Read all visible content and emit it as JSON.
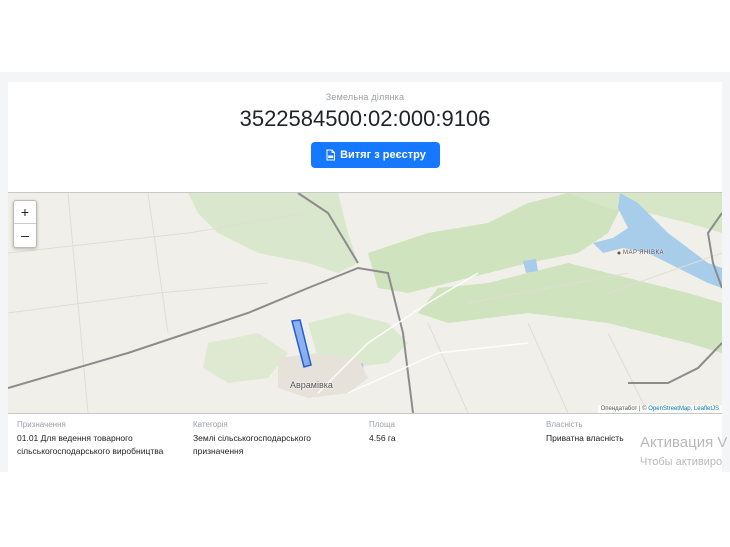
{
  "header": {
    "subtitle": "Земельна ділянка",
    "cadastral_number": "3522584500:02:000:9106",
    "extract_button_label": "Витяг з реєстру",
    "extract_button_icon": "pdf-file-icon"
  },
  "map": {
    "zoom_in_label": "+",
    "zoom_out_label": "–",
    "labels": {
      "village": "Аврамівка",
      "village2": "МАР'ЯНІВКА"
    },
    "attribution": {
      "prefix": "Опендатабот | © ",
      "links": "OpenStreetMap, LeafletJS"
    },
    "colors": {
      "background": "#f1efe9",
      "forest": "#d4e6c4",
      "water": "#a8cdea",
      "parcel": "#3d7df0",
      "boundary": "#8a8a8a"
    }
  },
  "details": {
    "purpose": {
      "label": "Призначення",
      "value": "01.01 Для ведення товарного сільськогосподарського виробництва"
    },
    "category": {
      "label": "Категорія",
      "value": "Землі сільськогосподарського призначення"
    },
    "area": {
      "label": "Площа",
      "value": "4.56 га"
    },
    "ownership": {
      "label": "Власність",
      "value": "Приватна власність"
    }
  },
  "watermark": {
    "line1": "Активация V",
    "line2": "Чтобы активиро"
  }
}
